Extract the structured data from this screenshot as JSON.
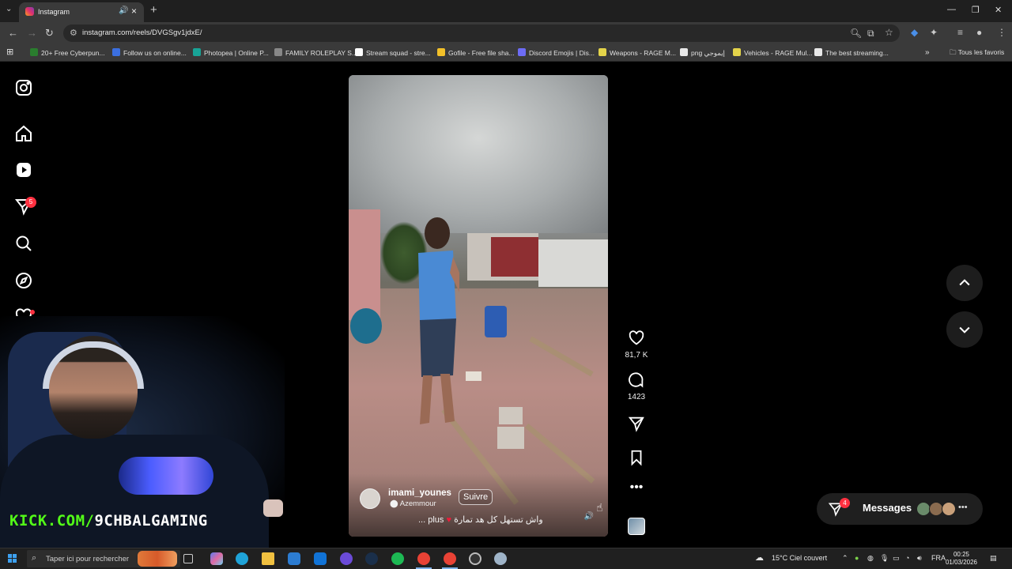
{
  "browser": {
    "tab_title": "Instagram",
    "url": "instagram.com/reels/DVGSgv1jdxE/",
    "bookmarks": [
      {
        "label": "20+ Free Cyberpun...",
        "color": "#2a7d2e"
      },
      {
        "label": "Follow us on online...",
        "color": "#3b6fe0"
      },
      {
        "label": "Photopea | Online P...",
        "color": "#18a497"
      },
      {
        "label": "FAMILY ROLEPLAY S...",
        "color": "#888888"
      },
      {
        "label": "Stream squad - stre...",
        "color": "#ffffff"
      },
      {
        "label": "Gofile - Free file sha...",
        "color": "#f2c029"
      },
      {
        "label": "Discord Emojis | Dis...",
        "color": "#6d6cf5"
      },
      {
        "label": "Weapons - RAGE M...",
        "color": "#e3d34a"
      },
      {
        "label": "png إيموجي",
        "color": "#e8e8e8"
      },
      {
        "label": "Vehicles - RAGE Mul...",
        "color": "#e3d34a"
      },
      {
        "label": "The best streaming...",
        "color": "#e8e8e8"
      }
    ],
    "all_favorites": "Tous les favoris"
  },
  "sidebar": {
    "notifications_count": "5"
  },
  "reel": {
    "username": "imami_younes",
    "location": "Azemmour",
    "follow_label": "Suivre",
    "caption_text": "واش تستهل كل هد تمارة",
    "caption_more": "... plus",
    "likes": "81,7 K",
    "comments": "1423"
  },
  "messages": {
    "label": "Messages",
    "badge": "4"
  },
  "overlay": {
    "kick_prefix": "KICK.COM/",
    "kick_channel": "9CHBALGAMING"
  },
  "taskbar": {
    "search_placeholder": "Taper ici pour rechercher",
    "weather": "15°C  Ciel couvert",
    "lang": "FRA",
    "time": "00:25",
    "date": "01/03/2026"
  },
  "colors": {
    "accent_red": "#ff3040",
    "kick_green": "#53fc18"
  }
}
